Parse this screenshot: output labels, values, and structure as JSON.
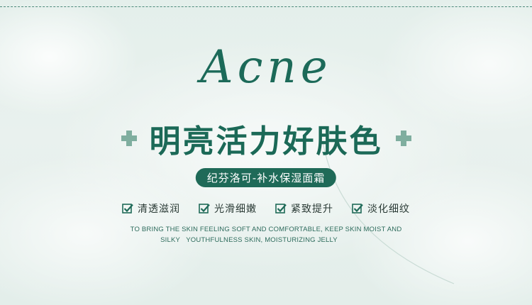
{
  "banner": {
    "script_title": "Acne",
    "headline": "明亮活力好肤色",
    "pill_text": "纪芬洛可-补水保湿面霜",
    "features": [
      {
        "icon": "checkbox-icon",
        "label": "清透滋润"
      },
      {
        "icon": "checkbox-icon",
        "label": "光滑细嫩"
      },
      {
        "icon": "checkbox-icon",
        "label": "紧致提升"
      },
      {
        "icon": "checkbox-icon",
        "label": "淡化细纹"
      }
    ],
    "subtitle_line1": "TO BRING THE SKIN FEELING SOFT AND COMFORTABLE, KEEP SKIN MOIST AND",
    "subtitle_line2": "SILKY   YOUTHFULNESS SKIN, MOISTURIZING JELLY"
  },
  "colors": {
    "accent": "#1f6a58",
    "plus": "#7fae9f",
    "background": "#e6f0ec"
  }
}
